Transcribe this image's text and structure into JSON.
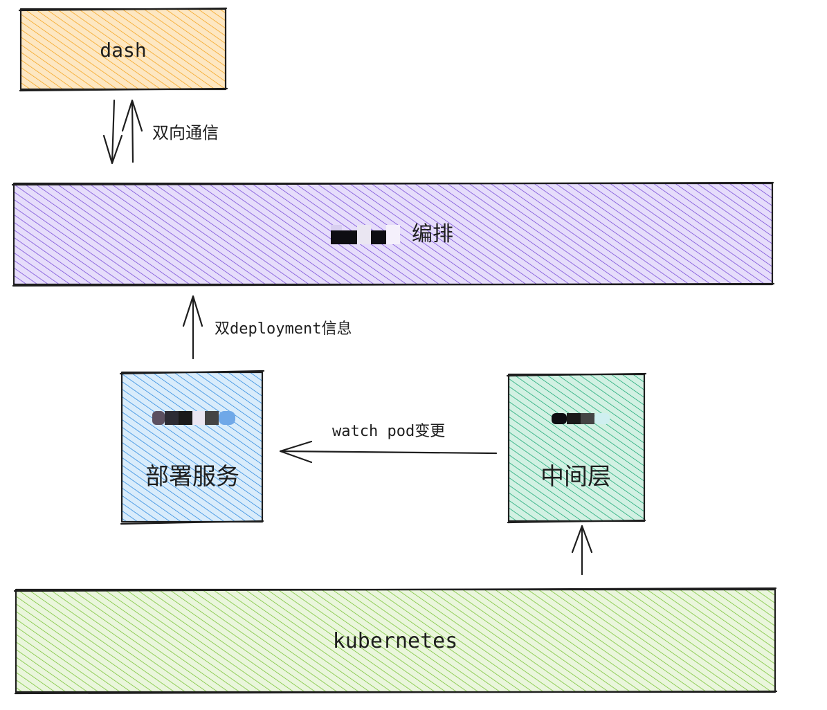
{
  "nodes": {
    "dash": {
      "label": "dash",
      "color": "#f5a623",
      "fill": "#fcd9a0"
    },
    "orchestration": {
      "label": "编排",
      "color": "#7a4fd8",
      "fill": "#d6c9f7"
    },
    "deploy_service": {
      "label": "部署服务",
      "color": "#2f8be0",
      "fill": "#c4e0f7"
    },
    "middle_layer": {
      "label": "中间层",
      "color": "#1eaa78",
      "fill": "#bfead8"
    },
    "kubernetes": {
      "label": "kubernetes",
      "color": "#7bc43a",
      "fill": "#dff0c9"
    }
  },
  "edges": {
    "dash_orchestration": {
      "label": "双向通信"
    },
    "deploy_orchestration": {
      "label": "双deployment信息"
    },
    "middle_deploy": {
      "label": "watch pod变更"
    }
  },
  "redaction_colors": [
    "#2c2c34",
    "#5b5060",
    "#d8cff0",
    "#0d0d12",
    "#eae6f2",
    "#6fa8e8",
    "#1a1a1a",
    "#444444",
    "#cfeff0"
  ]
}
